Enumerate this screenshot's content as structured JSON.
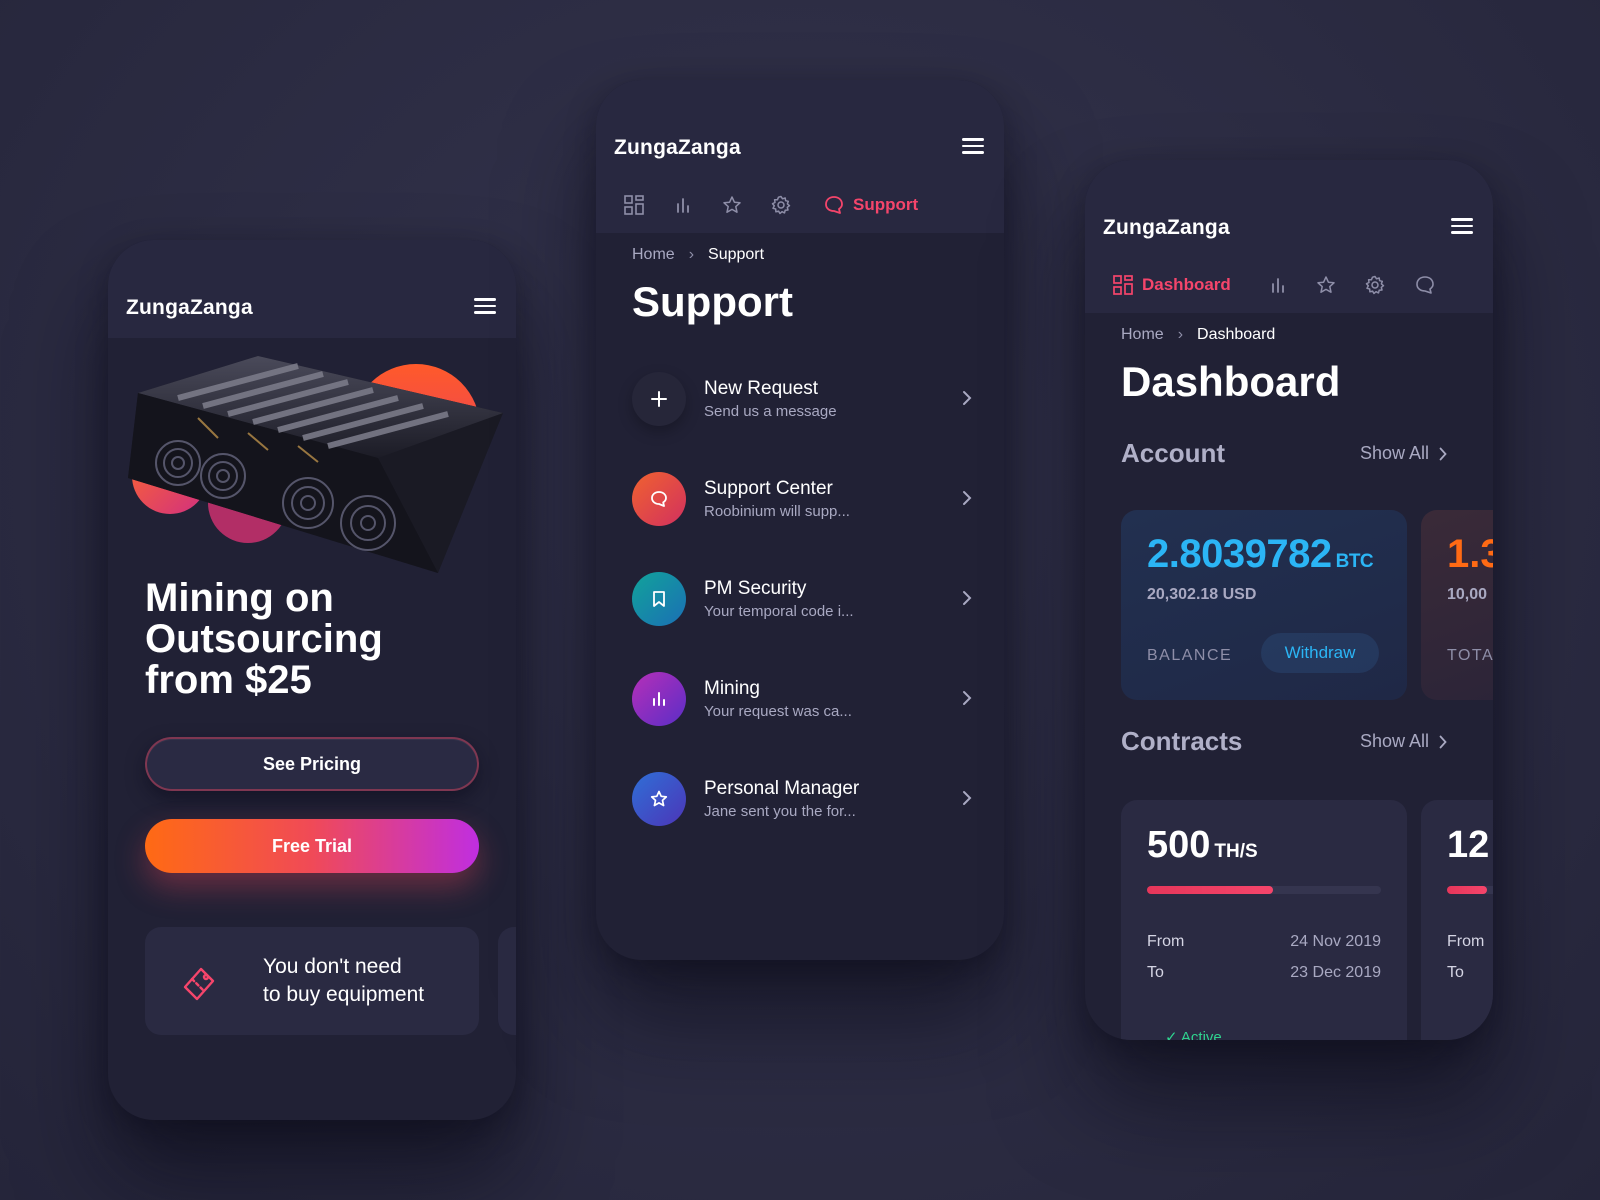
{
  "brand": "ZungaZanga",
  "colors": {
    "background": "#2c2c43",
    "card": "#212135",
    "accent_red": "#f5456b",
    "accent_blue": "#2bb5f5",
    "accent_orange": "#ff6a14",
    "gradient_end": "#c02ee0",
    "active_green": "#2fd38f"
  },
  "landing": {
    "title_line1": "Mining on",
    "title_line2": "Outsourcing",
    "title_line3": "from $25",
    "see_pricing": "See Pricing",
    "free_trial": "Free Trial",
    "info_card_icon": "ticket-icon",
    "info_line1": "You don't need",
    "info_line2": "to buy equipment"
  },
  "support": {
    "active_tab": "Support",
    "tabs": [
      "grid-icon",
      "bars-icon",
      "star-icon",
      "gear-icon",
      "chat-icon"
    ],
    "breadcrumb_home": "Home",
    "breadcrumb_current": "Support",
    "title": "Support",
    "items": [
      {
        "title": "New Request",
        "subtitle": "Send us a message",
        "icon": "plus-icon"
      },
      {
        "title": "Support Center",
        "subtitle": "Roobinium will supp...",
        "icon": "chat-icon"
      },
      {
        "title": "PM Security",
        "subtitle": "Your temporal code i...",
        "icon": "bookmark-icon"
      },
      {
        "title": "Mining",
        "subtitle": "Your request was ca...",
        "icon": "bars-icon"
      },
      {
        "title": "Personal Manager",
        "subtitle": "Jane sent you the for...",
        "icon": "star-icon"
      }
    ]
  },
  "dashboard": {
    "active_tab": "Dashboard",
    "breadcrumb_home": "Home",
    "breadcrumb_current": "Dashboard",
    "title": "Dashboard",
    "account_title": "Account",
    "contracts_title": "Contracts",
    "show_all": "Show All",
    "account": {
      "btc_value": "2.8039782",
      "btc_unit": "BTC",
      "usd_value": "20,302.18 USD",
      "balance_label": "BALANCE",
      "withdraw": "Withdraw"
    },
    "account_peek": {
      "value": "1.3",
      "sub": "10,00",
      "label": "TOTA"
    },
    "contract": {
      "hashrate": "500",
      "hashrate_unit": "TH/S",
      "progress": 0.54,
      "from_label": "From",
      "from_value": "24 Nov 2019",
      "to_label": "To",
      "to_value": "23 Dec 2019",
      "status": "✓ Active"
    },
    "contract_peek": {
      "hashrate": "12",
      "from_label": "From",
      "to_label": "To"
    }
  }
}
